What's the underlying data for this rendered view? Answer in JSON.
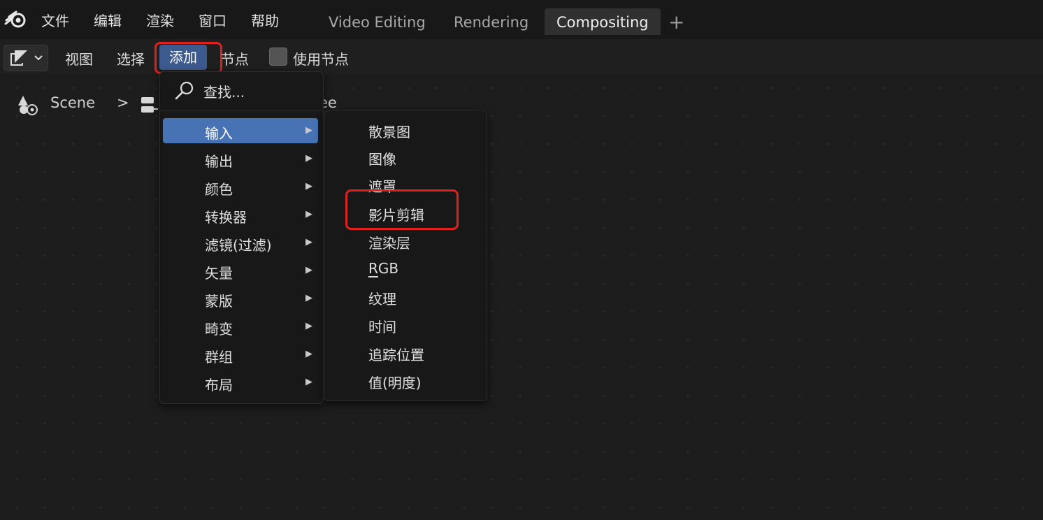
{
  "topbar": {
    "menus": [
      "文件",
      "编辑",
      "渲染",
      "窗口",
      "帮助"
    ],
    "workspace_tabs": [
      "Video Editing",
      "Rendering",
      "Compositing"
    ],
    "active_tab": "Compositing",
    "add_tab_icon": "+"
  },
  "header": {
    "menus": [
      "视图",
      "选择",
      "添加",
      "节点"
    ],
    "use_nodes_label": "使用节点",
    "use_nodes_checked": false
  },
  "breadcrumb": {
    "scene": "Scene",
    "separator": ">",
    "tree_partial": "ee"
  },
  "add_menu": {
    "search_label": "查找...",
    "items": [
      "输入",
      "输出",
      "颜色",
      "转换器",
      "滤镜(过滤)",
      "矢量",
      "蒙版",
      "畸变",
      "群组",
      "布局"
    ],
    "highlighted": "输入"
  },
  "input_submenu": {
    "items_prefix": [
      "散景图",
      "图像",
      "遮罩",
      "影片剪辑",
      "渲染层"
    ],
    "rgb_first": "R",
    "rgb_rest": "GB",
    "items_suffix": [
      "纹理",
      "时间",
      "追踪位置",
      "值(明度)"
    ]
  },
  "colors": {
    "accent": "#4772b3",
    "button_active": "#3c5a8e",
    "highlight_box": "#e0211d",
    "background": "#1d1d1d"
  },
  "icons": [
    "blender-logo-icon",
    "compositor-editor-icon",
    "chevron-down-icon",
    "search-icon",
    "scene-icon",
    "node-tree-icon",
    "submenu-arrow-icon"
  ]
}
